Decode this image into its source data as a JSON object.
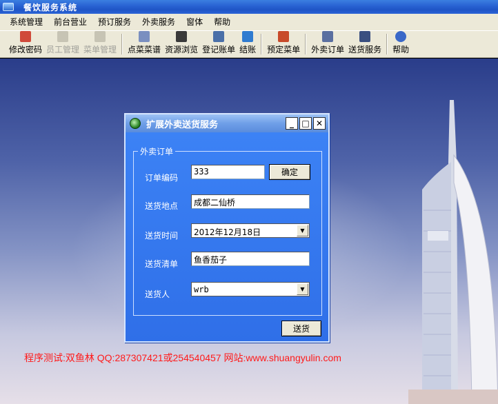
{
  "window": {
    "title": "餐饮服务系统"
  },
  "menu": [
    "系统管理",
    "前台营业",
    "预订服务",
    "外卖服务",
    "窗体",
    "帮助"
  ],
  "toolbar": [
    {
      "label": "修改密码",
      "enabled": true,
      "icon": "key-user-icon",
      "color": "#d04a3a"
    },
    {
      "label": "员工管理",
      "enabled": false,
      "icon": "employee-icon",
      "color": "#c7c4b4"
    },
    {
      "label": "菜单管理",
      "enabled": false,
      "icon": "menu-book-icon",
      "color": "#c7c4b4"
    },
    {
      "label": "点菜菜谱",
      "enabled": true,
      "icon": "recipe-icon",
      "color": "#7a8fc0"
    },
    {
      "label": "资源浏览",
      "enabled": true,
      "icon": "person-browse-icon",
      "color": "#3a3a3a"
    },
    {
      "label": "登记账单",
      "enabled": true,
      "icon": "bill-register-icon",
      "color": "#4a6fa8"
    },
    {
      "label": "结账",
      "enabled": true,
      "icon": "checkout-icon",
      "color": "#2f7bd0"
    },
    {
      "label": "预定菜单",
      "enabled": true,
      "icon": "reserve-menu-icon",
      "color": "#c84a2a"
    },
    {
      "label": "外卖订单",
      "enabled": true,
      "icon": "takeout-order-icon",
      "color": "#5a6fa0"
    },
    {
      "label": "送货服务",
      "enabled": true,
      "icon": "delivery-icon",
      "color": "#3a4f80"
    },
    {
      "label": "帮助",
      "enabled": true,
      "icon": "help-icon",
      "color": "#3a68c8"
    }
  ],
  "dialog": {
    "title": "扩展外卖送货服务",
    "group_label": "外卖订单",
    "order_code": {
      "label": "订单编码",
      "value": "333"
    },
    "confirm_button": "确定",
    "address": {
      "label": "送货地点",
      "value": "成都二仙桥"
    },
    "time": {
      "label": "送货时间",
      "value": "2012年12月18日"
    },
    "items": {
      "label": "送货清单",
      "value": "鱼香茄子"
    },
    "courier": {
      "label": "送货人",
      "value": "wrb"
    },
    "send_button": "送货"
  },
  "watermark": "程序测试:双鱼林 QQ:287307421或254540457 网站:www.shuangyulin.com"
}
